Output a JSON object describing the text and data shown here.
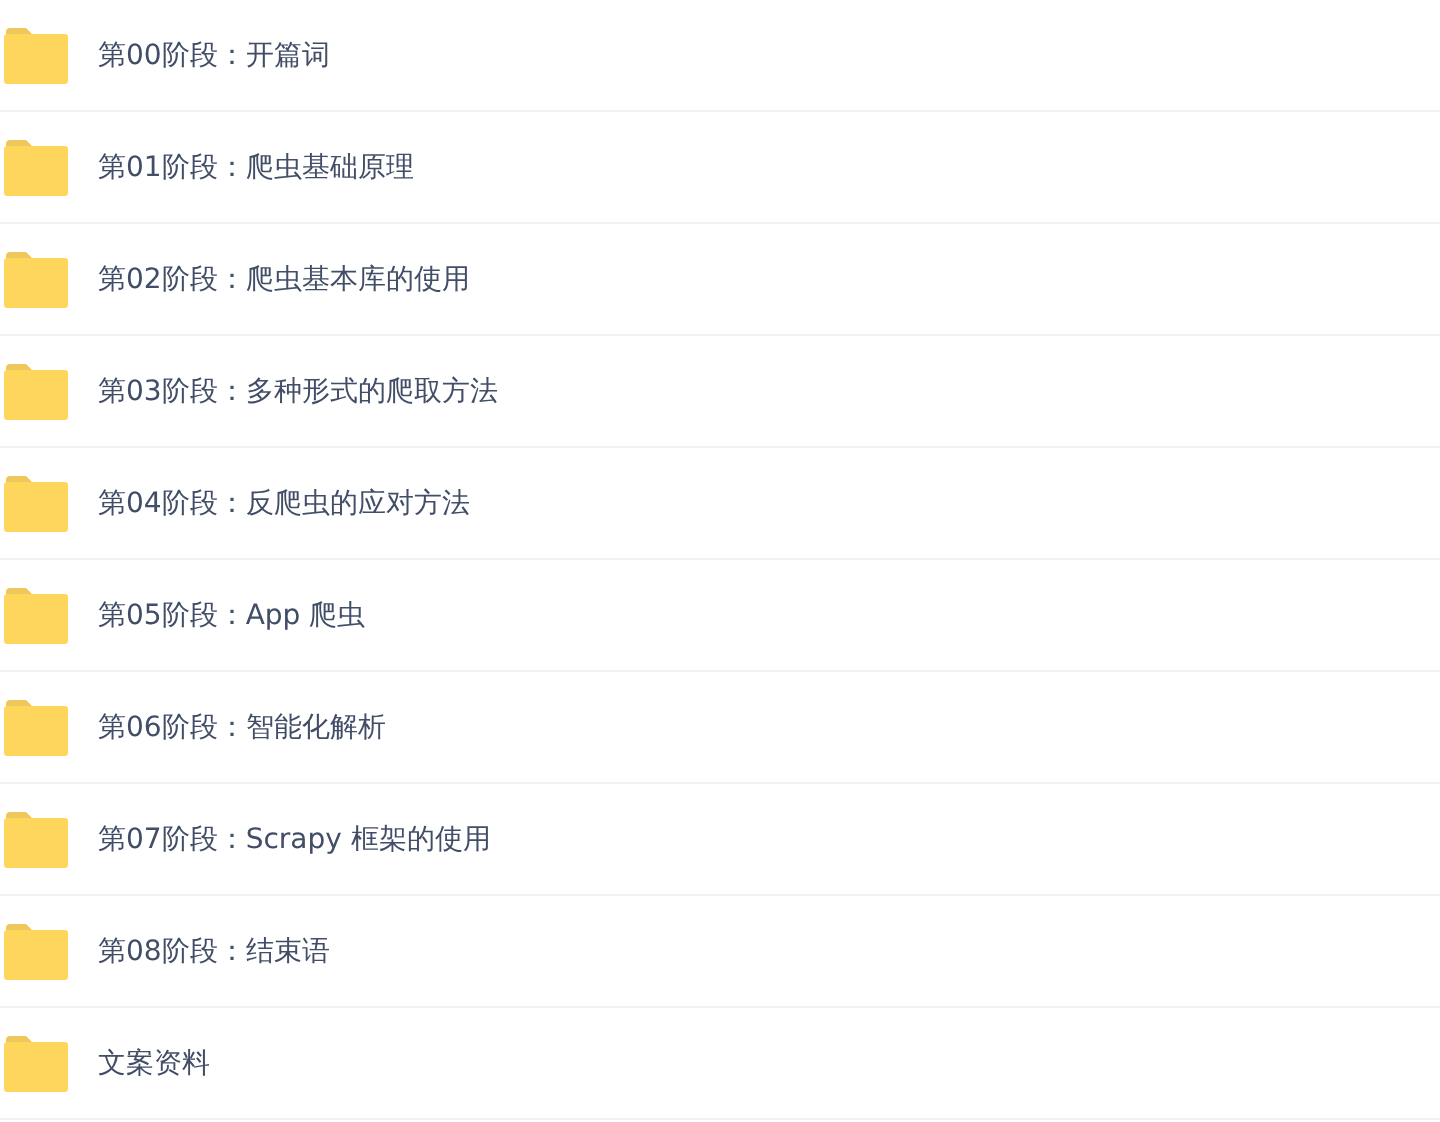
{
  "folders": [
    {
      "name": "第00阶段：开篇词"
    },
    {
      "name": "第01阶段：爬虫基础原理"
    },
    {
      "name": "第02阶段：爬虫基本库的使用"
    },
    {
      "name": "第03阶段：多种形式的爬取方法"
    },
    {
      "name": "第04阶段：反爬虫的应对方法"
    },
    {
      "name": "第05阶段：App 爬虫"
    },
    {
      "name": "第06阶段：智能化解析"
    },
    {
      "name": "第07阶段：Scrapy 框架的使用"
    },
    {
      "name": "第08阶段：结束语"
    },
    {
      "name": "文案资料"
    }
  ]
}
